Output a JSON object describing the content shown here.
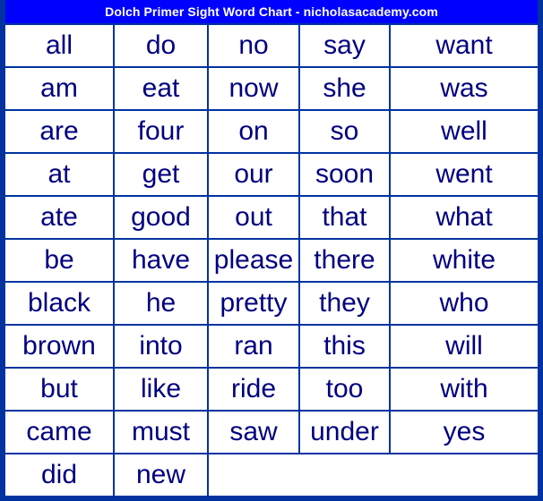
{
  "title": "Dolch Primer Sight Word Chart - nicholasacademy.com",
  "colors": {
    "frame": "#0033a0",
    "title_bar": "#0000ff",
    "title_text": "#ffffff",
    "cell_background": "#ffffff",
    "word_text": "#000080",
    "grid_line": "#0033a0"
  },
  "grid": {
    "columns": 5,
    "rows": 11,
    "rows_data": [
      [
        "all",
        "do",
        "no",
        "say",
        "want"
      ],
      [
        "am",
        "eat",
        "now",
        "she",
        "was"
      ],
      [
        "are",
        "four",
        "on",
        "so",
        "well"
      ],
      [
        "at",
        "get",
        "our",
        "soon",
        "went"
      ],
      [
        "ate",
        "good",
        "out",
        "that",
        "what"
      ],
      [
        "be",
        "have",
        "please",
        "there",
        "white"
      ],
      [
        "black",
        "he",
        "pretty",
        "they",
        "who"
      ],
      [
        "brown",
        "into",
        "ran",
        "this",
        "will"
      ],
      [
        "but",
        "like",
        "ride",
        "too",
        "with"
      ],
      [
        "came",
        "must",
        "saw",
        "under",
        "yes"
      ],
      [
        "did",
        "new",
        "",
        "",
        ""
      ]
    ],
    "columns_data": [
      [
        "all",
        "am",
        "are",
        "at",
        "ate",
        "be",
        "black",
        "brown",
        "but",
        "came",
        "did"
      ],
      [
        "do",
        "eat",
        "four",
        "get",
        "good",
        "have",
        "he",
        "into",
        "like",
        "must",
        "new"
      ],
      [
        "no",
        "now",
        "on",
        "our",
        "out",
        "please",
        "pretty",
        "ran",
        "ride",
        "saw"
      ],
      [
        "say",
        "she",
        "so",
        "soon",
        "that",
        "there",
        "they",
        "this",
        "too",
        "under"
      ],
      [
        "want",
        "was",
        "well",
        "went",
        "what",
        "white",
        "who",
        "will",
        "with",
        "yes"
      ]
    ],
    "word_count": 52
  }
}
